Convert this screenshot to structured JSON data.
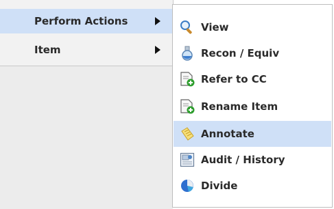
{
  "main_menu": {
    "items": [
      {
        "label": "Perform Actions",
        "active": true
      },
      {
        "label": "Item",
        "active": false
      }
    ]
  },
  "submenu": {
    "items": [
      {
        "label": "View",
        "icon": "magnifier-icon"
      },
      {
        "label": "Recon / Equiv",
        "icon": "flask-icon"
      },
      {
        "label": "Refer to CC",
        "icon": "document-add-icon"
      },
      {
        "label": "Rename Item",
        "icon": "document-add-icon"
      },
      {
        "label": "Annotate",
        "icon": "notepad-icon",
        "highlighted": true
      },
      {
        "label": "Audit / History",
        "icon": "report-icon"
      },
      {
        "label": "Divide",
        "icon": "pie-chart-icon"
      }
    ]
  },
  "colors": {
    "highlight": "#cfe0f7",
    "menu_bg": "#f2f2f2",
    "text": "#2a2a2a"
  }
}
